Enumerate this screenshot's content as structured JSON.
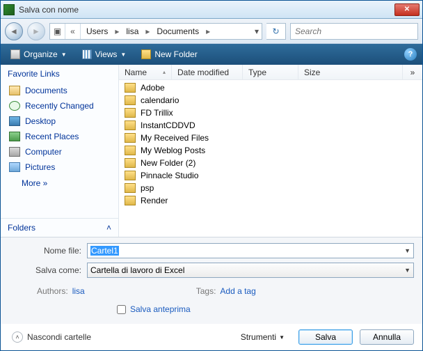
{
  "window": {
    "title": "Salva con nome"
  },
  "nav": {
    "segments": [
      "Users",
      "lisa",
      "Documents"
    ],
    "search_placeholder": "Search"
  },
  "toolbar": {
    "organize": "Organize",
    "views": "Views",
    "new_folder": "New Folder"
  },
  "sidebar": {
    "header": "Favorite Links",
    "items": [
      {
        "label": "Documents",
        "icon": "folder"
      },
      {
        "label": "Recently Changed",
        "icon": "clock"
      },
      {
        "label": "Desktop",
        "icon": "desktop"
      },
      {
        "label": "Recent Places",
        "icon": "recent"
      },
      {
        "label": "Computer",
        "icon": "computer"
      },
      {
        "label": "Pictures",
        "icon": "pictures"
      }
    ],
    "more": "More  »",
    "folders": "Folders"
  },
  "columns": {
    "name": "Name",
    "date": "Date modified",
    "type": "Type",
    "size": "Size",
    "overflow": "»"
  },
  "files": [
    "Adobe",
    "calendario",
    "FD Trillix",
    "InstantCDDVD",
    "My Received Files",
    "My Weblog Posts",
    "New Folder (2)",
    "Pinnacle Studio",
    "psp",
    "Render"
  ],
  "form": {
    "filename_label": "Nome file:",
    "filename_value": "Cartel1",
    "savetype_label": "Salva come:",
    "savetype_value": "Cartella di lavoro di Excel",
    "authors_label": "Authors:",
    "authors_value": "lisa",
    "tags_label": "Tags:",
    "tags_value": "Add a tag",
    "thumbnail_label": "Salva anteprima"
  },
  "footer": {
    "hide": "Nascondi cartelle",
    "tools": "Strumenti",
    "save": "Salva",
    "cancel": "Annulla"
  }
}
